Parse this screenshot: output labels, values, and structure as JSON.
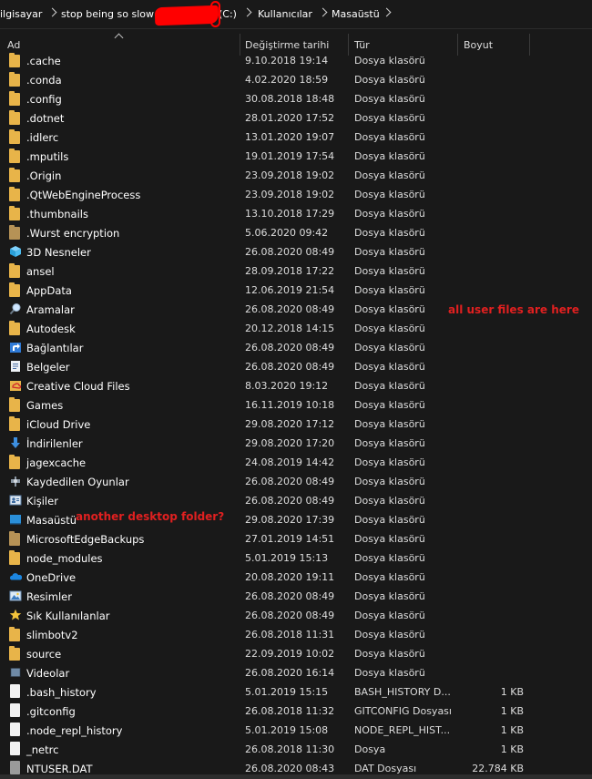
{
  "breadcrumb": {
    "items": [
      "ilgisayar",
      "stop being so slow",
      "(C:)",
      "Kullanıcılar",
      "Masaüstü"
    ]
  },
  "columns": {
    "name": "Ad",
    "date": "Değiştirme tarihi",
    "type": "Tür",
    "size": "Boyut"
  },
  "annotations": {
    "user_files": "all user files are here",
    "desktop": "another desktop folder?"
  },
  "rows": [
    {
      "name": ".cache",
      "date": "9.10.2018 19:14",
      "type": "Dosya klasörü",
      "size": "",
      "icon": "folder"
    },
    {
      "name": ".conda",
      "date": "4.02.2020 18:59",
      "type": "Dosya klasörü",
      "size": "",
      "icon": "folder"
    },
    {
      "name": ".config",
      "date": "30.08.2018 18:48",
      "type": "Dosya klasörü",
      "size": "",
      "icon": "folder"
    },
    {
      "name": ".dotnet",
      "date": "28.01.2020 17:52",
      "type": "Dosya klasörü",
      "size": "",
      "icon": "folder"
    },
    {
      "name": ".idlerc",
      "date": "13.01.2020 19:07",
      "type": "Dosya klasörü",
      "size": "",
      "icon": "folder"
    },
    {
      "name": ".mputils",
      "date": "19.01.2019 17:54",
      "type": "Dosya klasörü",
      "size": "",
      "icon": "folder"
    },
    {
      "name": ".Origin",
      "date": "23.09.2018 19:02",
      "type": "Dosya klasörü",
      "size": "",
      "icon": "folder"
    },
    {
      "name": ".QtWebEngineProcess",
      "date": "23.09.2018 19:02",
      "type": "Dosya klasörü",
      "size": "",
      "icon": "folder"
    },
    {
      "name": ".thumbnails",
      "date": "13.10.2018 17:29",
      "type": "Dosya klasörü",
      "size": "",
      "icon": "folder"
    },
    {
      "name": ".Wurst encryption",
      "date": "5.06.2020 09:42",
      "type": "Dosya klasörü",
      "size": "",
      "icon": "folder-tan"
    },
    {
      "name": "3D Nesneler",
      "date": "26.08.2020 08:49",
      "type": "Dosya klasörü",
      "size": "",
      "icon": "3d-objects"
    },
    {
      "name": "ansel",
      "date": "28.09.2018 17:22",
      "type": "Dosya klasörü",
      "size": "",
      "icon": "folder"
    },
    {
      "name": "AppData",
      "date": "12.06.2019 21:54",
      "type": "Dosya klasörü",
      "size": "",
      "icon": "folder"
    },
    {
      "name": "Aramalar",
      "date": "26.08.2020 08:49",
      "type": "Dosya klasörü",
      "size": "",
      "icon": "search"
    },
    {
      "name": "Autodesk",
      "date": "20.12.2018 14:15",
      "type": "Dosya klasörü",
      "size": "",
      "icon": "folder"
    },
    {
      "name": "Bağlantılar",
      "date": "26.08.2020 08:49",
      "type": "Dosya klasörü",
      "size": "",
      "icon": "links"
    },
    {
      "name": "Belgeler",
      "date": "26.08.2020 08:49",
      "type": "Dosya klasörü",
      "size": "",
      "icon": "documents"
    },
    {
      "name": "Creative Cloud Files",
      "date": "8.03.2020 19:12",
      "type": "Dosya klasörü",
      "size": "",
      "icon": "creative-cloud"
    },
    {
      "name": "Games",
      "date": "16.11.2019 10:18",
      "type": "Dosya klasörü",
      "size": "",
      "icon": "folder"
    },
    {
      "name": "iCloud Drive",
      "date": "29.08.2020 17:12",
      "type": "Dosya klasörü",
      "size": "",
      "icon": "folder"
    },
    {
      "name": "İndirilenler",
      "date": "29.08.2020 17:20",
      "type": "Dosya klasörü",
      "size": "",
      "icon": "downloads"
    },
    {
      "name": "jagexcache",
      "date": "24.08.2019 14:42",
      "type": "Dosya klasörü",
      "size": "",
      "icon": "folder"
    },
    {
      "name": "Kaydedilen Oyunlar",
      "date": "26.08.2020 08:49",
      "type": "Dosya klasörü",
      "size": "",
      "icon": "saved-games"
    },
    {
      "name": "Kişiler",
      "date": "26.08.2020 08:49",
      "type": "Dosya klasörü",
      "size": "",
      "icon": "contacts"
    },
    {
      "name": "Masaüstü",
      "date": "29.08.2020 17:39",
      "type": "Dosya klasörü",
      "size": "",
      "icon": "desktop"
    },
    {
      "name": "MicrosoftEdgeBackups",
      "date": "27.01.2019 14:51",
      "type": "Dosya klasörü",
      "size": "",
      "icon": "folder-tan"
    },
    {
      "name": "node_modules",
      "date": "5.01.2019 15:13",
      "type": "Dosya klasörü",
      "size": "",
      "icon": "folder"
    },
    {
      "name": "OneDrive",
      "date": "20.08.2020 19:11",
      "type": "Dosya klasörü",
      "size": "",
      "icon": "onedrive"
    },
    {
      "name": "Resimler",
      "date": "26.08.2020 08:49",
      "type": "Dosya klasörü",
      "size": "",
      "icon": "pictures"
    },
    {
      "name": "Sık Kullanılanlar",
      "date": "26.08.2020 08:49",
      "type": "Dosya klasörü",
      "size": "",
      "icon": "favorites"
    },
    {
      "name": "slimbotv2",
      "date": "26.08.2018 11:31",
      "type": "Dosya klasörü",
      "size": "",
      "icon": "folder"
    },
    {
      "name": "source",
      "date": "22.09.2019 10:02",
      "type": "Dosya klasörü",
      "size": "",
      "icon": "folder"
    },
    {
      "name": "Videolar",
      "date": "26.08.2020 16:14",
      "type": "Dosya klasörü",
      "size": "",
      "icon": "videos"
    },
    {
      "name": ".bash_history",
      "date": "5.01.2019 15:15",
      "type": "BASH_HISTORY D...",
      "size": "1 KB",
      "icon": "file"
    },
    {
      "name": ".gitconfig",
      "date": "26.08.2018 11:32",
      "type": "GITCONFIG Dosyası",
      "size": "1 KB",
      "icon": "file"
    },
    {
      "name": ".node_repl_history",
      "date": "5.01.2019 15:08",
      "type": "NODE_REPL_HIST...",
      "size": "1 KB",
      "icon": "file"
    },
    {
      "name": "_netrc",
      "date": "26.08.2018 11:30",
      "type": "Dosya",
      "size": "1 KB",
      "icon": "file"
    },
    {
      "name": "NTUSER.DAT",
      "date": "26.08.2020 08:43",
      "type": "DAT Dosyası",
      "size": "22.784 KB",
      "icon": "dat-file"
    }
  ]
}
